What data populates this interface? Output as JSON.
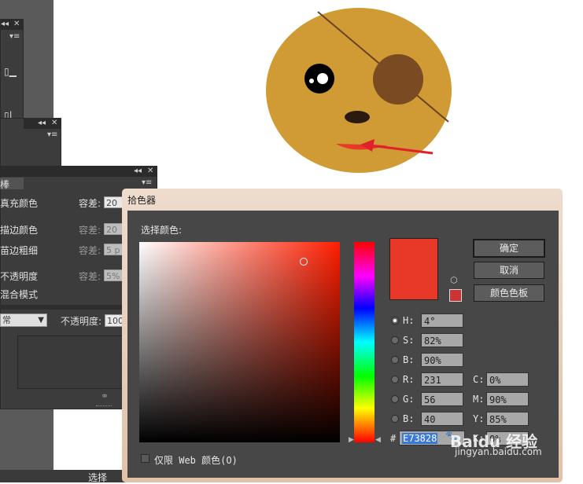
{
  "left_panel": {
    "labels": {
      "tab_fragment": "棒",
      "fill_color": "真充颜色",
      "stroke_color": "描边颜色",
      "stroke_width": "苗边粗细",
      "opacity": "不透明度",
      "blend_mode": "混合模式"
    },
    "tolerance_label": "容差:",
    "tolerance_values": [
      "20",
      "20",
      "5 p",
      "5%"
    ],
    "mode_select": "常",
    "opacity_label": "不透明度:",
    "opacity_value": "100"
  },
  "bottom_bar": {
    "label": "选择"
  },
  "color_picker": {
    "title": "拾色器",
    "select_label": "选择颜色:",
    "buttons": {
      "ok": "确定",
      "cancel": "取消",
      "swatches": "颜色色板"
    },
    "hsb": [
      {
        "label": "H:",
        "value": "4°",
        "selected": true
      },
      {
        "label": "S:",
        "value": "82%"
      },
      {
        "label": "B:",
        "value": "90%"
      }
    ],
    "rgb": [
      {
        "label": "R:",
        "value": "231"
      },
      {
        "label": "G:",
        "value": "56"
      },
      {
        "label": "B:",
        "value": "40"
      }
    ],
    "cmyk": [
      {
        "label": "C:",
        "value": "0%"
      },
      {
        "label": "M:",
        "value": "90%"
      },
      {
        "label": "Y:",
        "value": "85%"
      },
      {
        "label": "K:",
        "value": "0%"
      }
    ],
    "hex_label": "#",
    "hex_value": "E73828",
    "web_only_label": "仅限 Web 颜色(O)",
    "current_color": "#e73828",
    "web_safe_color": "#cc3333"
  },
  "watermark": {
    "line1": "Baidu 经验",
    "line2": "jingyan.baidu.com"
  },
  "colors": {
    "face": "#d09a34",
    "eye_patch": "#7a4a22",
    "arrow": "#e0202a"
  }
}
